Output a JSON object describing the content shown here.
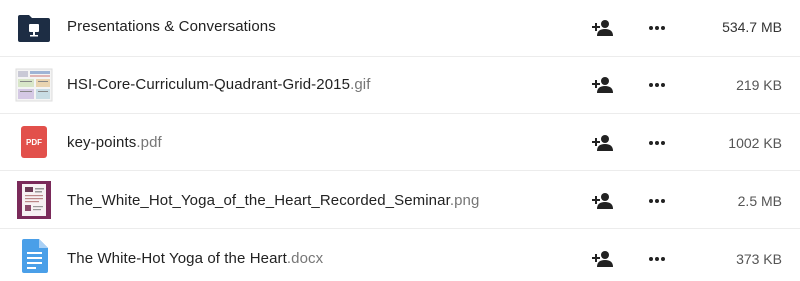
{
  "colors": {
    "folder": "#1d2d44",
    "pdf": "#e2504b",
    "docx": "#4a9fe8",
    "accent_image": "#7a2a5a"
  },
  "files": [
    {
      "icon": "folder-icon",
      "name": "Presentations & Conversations",
      "ext": "",
      "size": "534.7 MB"
    },
    {
      "icon": "image-thumbnail",
      "name": "HSI-Core-Curriculum-Quadrant-Grid-2015",
      "ext": ".gif",
      "size": "219 KB"
    },
    {
      "icon": "pdf-icon",
      "name": "key-points",
      "ext": ".pdf",
      "size": "1002 KB",
      "badge": "PDF"
    },
    {
      "icon": "image-thumbnail",
      "name": "The_White_Hot_Yoga_of_the_Heart_Recorded_Seminar",
      "ext": ".png",
      "size": "2.5 MB"
    },
    {
      "icon": "document-icon",
      "name": "The White-Hot Yoga of the Heart",
      "ext": ".docx",
      "size": "373 KB"
    }
  ]
}
